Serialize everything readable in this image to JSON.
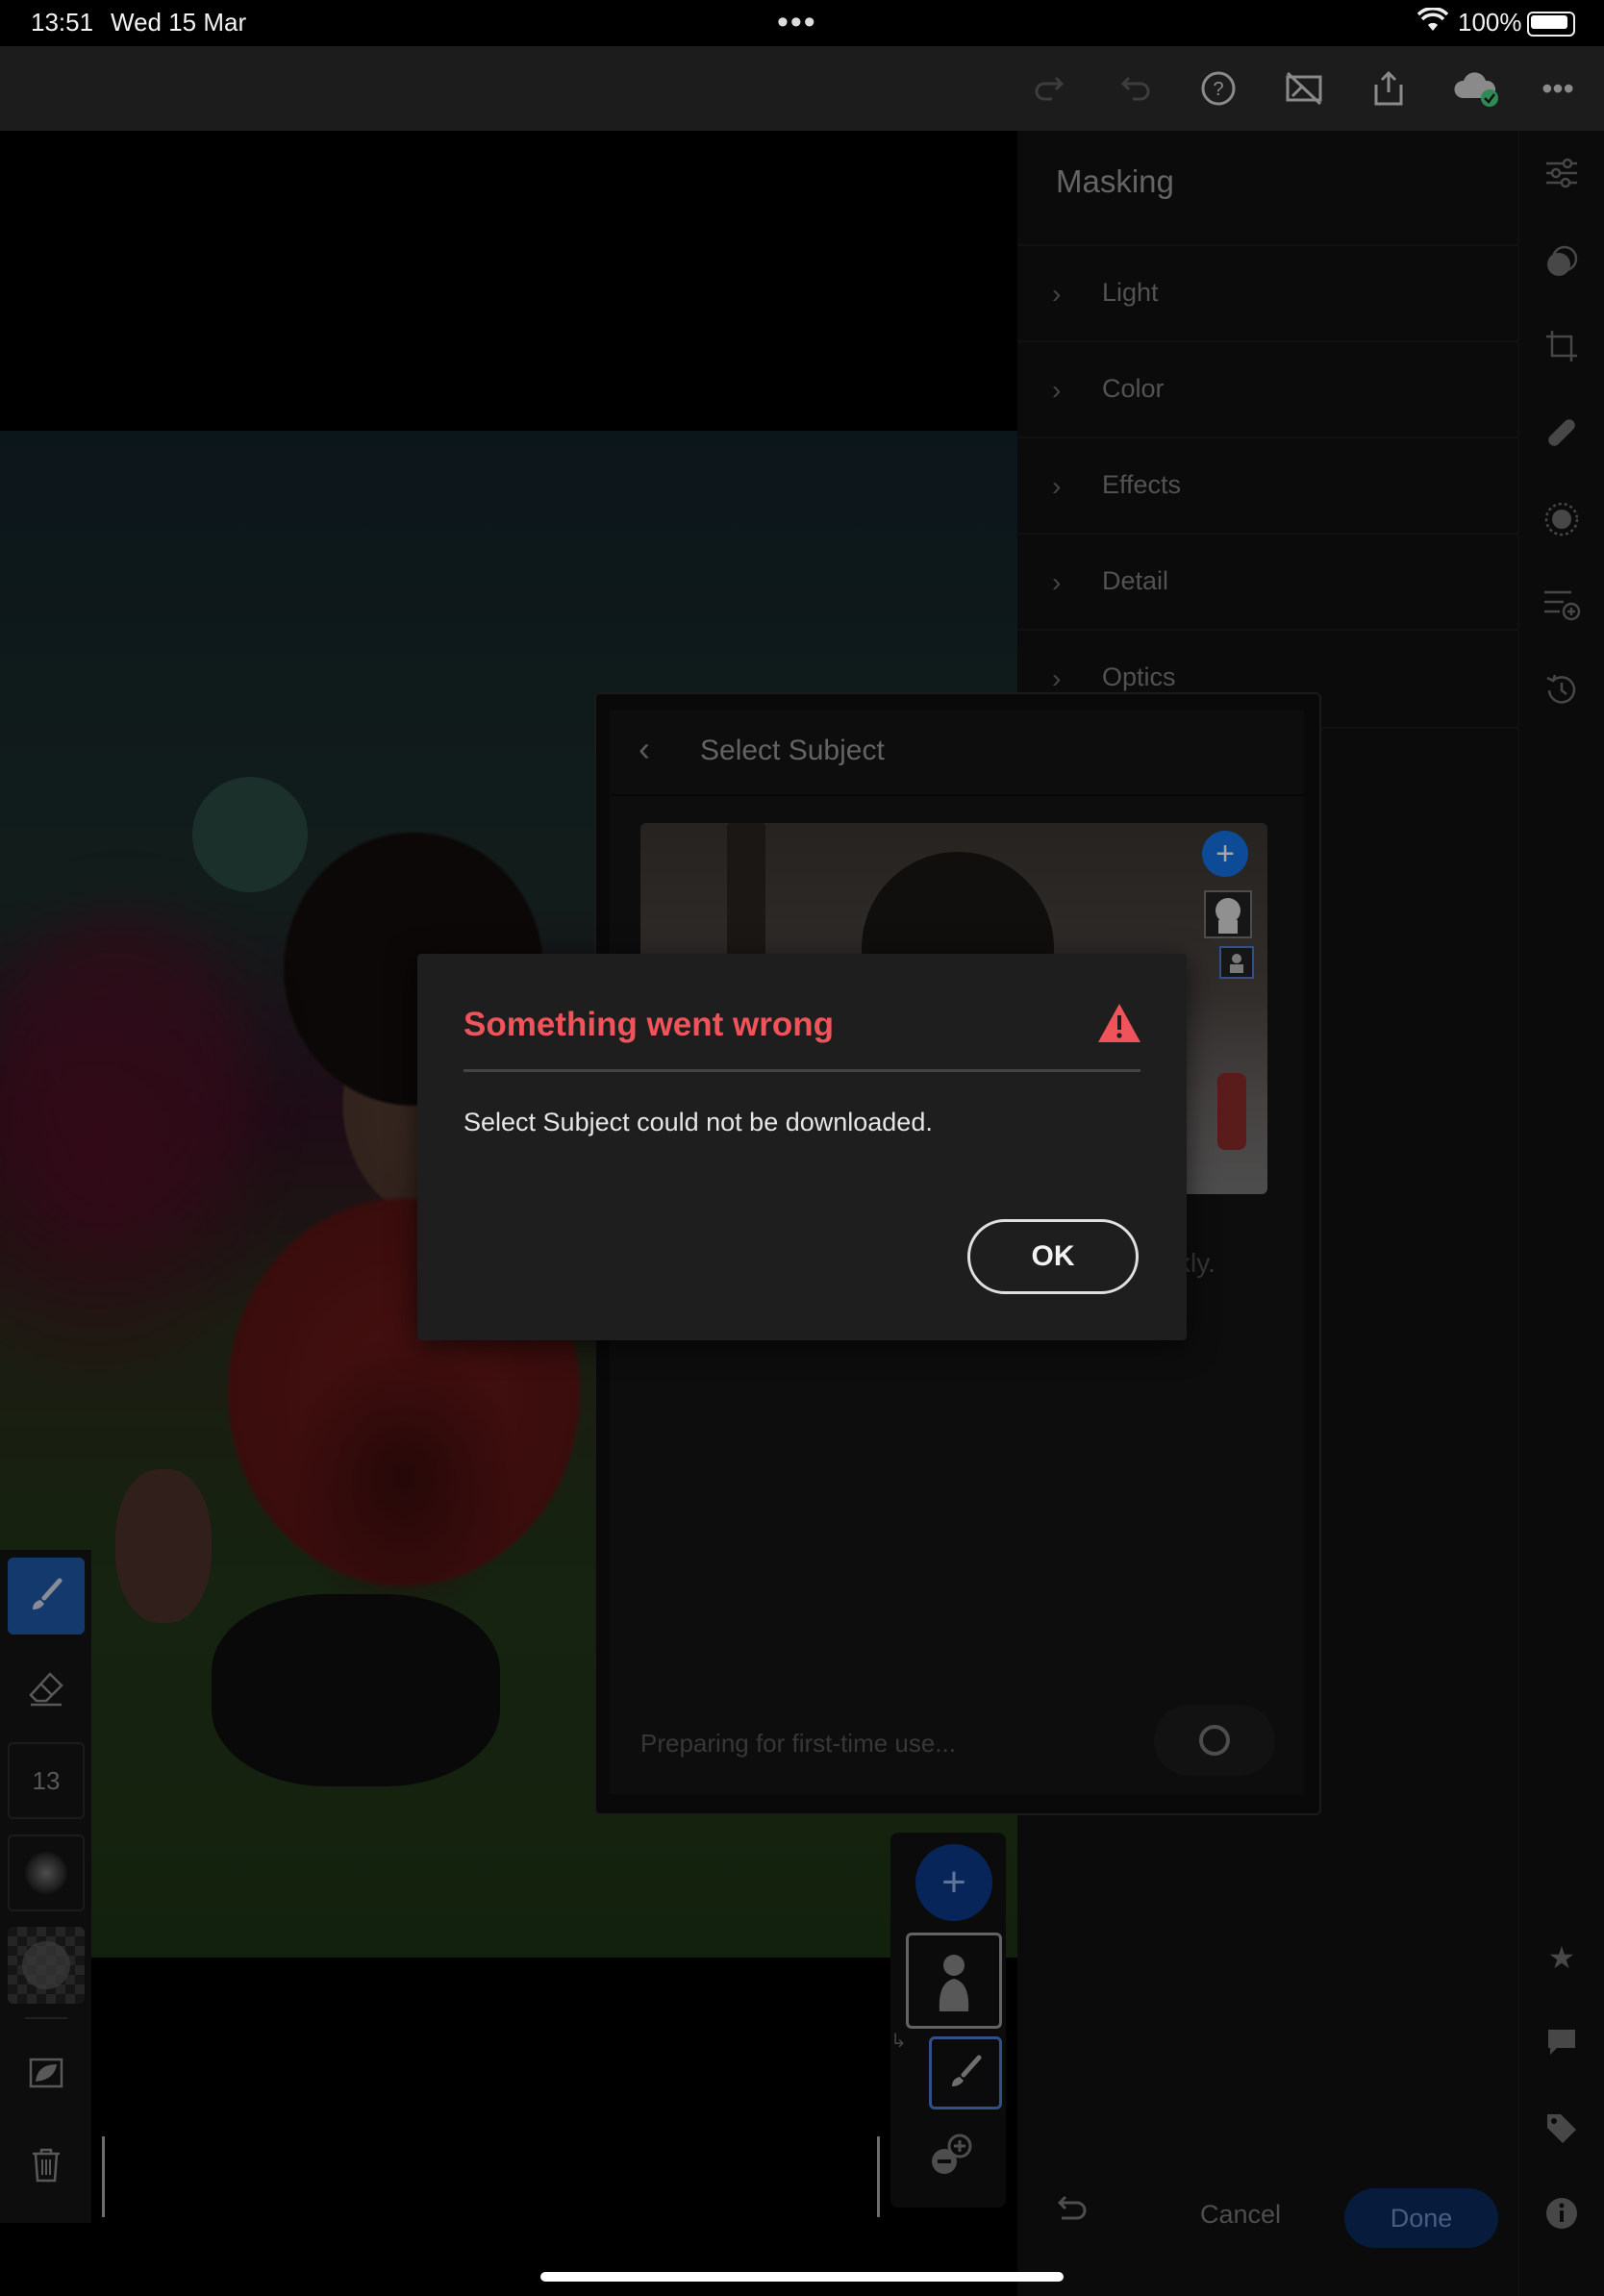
{
  "status_bar": {
    "time": "13:51",
    "date": "Wed 15 Mar",
    "multitask": "•••",
    "wifi_icon": "wifi-icon",
    "battery_percent": "100%"
  },
  "toolbar": {
    "icons": [
      "redo-icon",
      "undo-icon",
      "help-icon",
      "compare-off-icon",
      "share-icon",
      "cloud-synced-icon",
      "more-icon"
    ],
    "more_label": "•••"
  },
  "panel": {
    "title": "Masking",
    "sections": [
      {
        "label": "Light"
      },
      {
        "label": "Color"
      },
      {
        "label": "Effects"
      },
      {
        "label": "Detail"
      },
      {
        "label": "Optics"
      }
    ]
  },
  "right_strip": {
    "icons": [
      "edit-sliders-icon",
      "masking-icon",
      "crop-icon",
      "healing-icon",
      "selective-icon",
      "presets-icon",
      "history-icon",
      "star-icon",
      "comment-icon",
      "tag-icon",
      "info-icon"
    ]
  },
  "left_tools": {
    "brush_size": "13",
    "icons": [
      "brush-icon",
      "eraser-icon",
      "feather-icon",
      "density-icon",
      "overlay-toggle-icon",
      "delete-icon"
    ]
  },
  "select_subject": {
    "title": "Select Subject",
    "helper_fragment": "kly.",
    "status": "Preparing for first-time use..."
  },
  "dialog": {
    "title": "Something went wrong",
    "message": "Select Subject could not be downloaded.",
    "ok_label": "OK",
    "accent": "#f0535a"
  },
  "bottom_bar": {
    "cancel_label": "Cancel",
    "done_label": "Done",
    "done_color": "#0b2a5c"
  }
}
